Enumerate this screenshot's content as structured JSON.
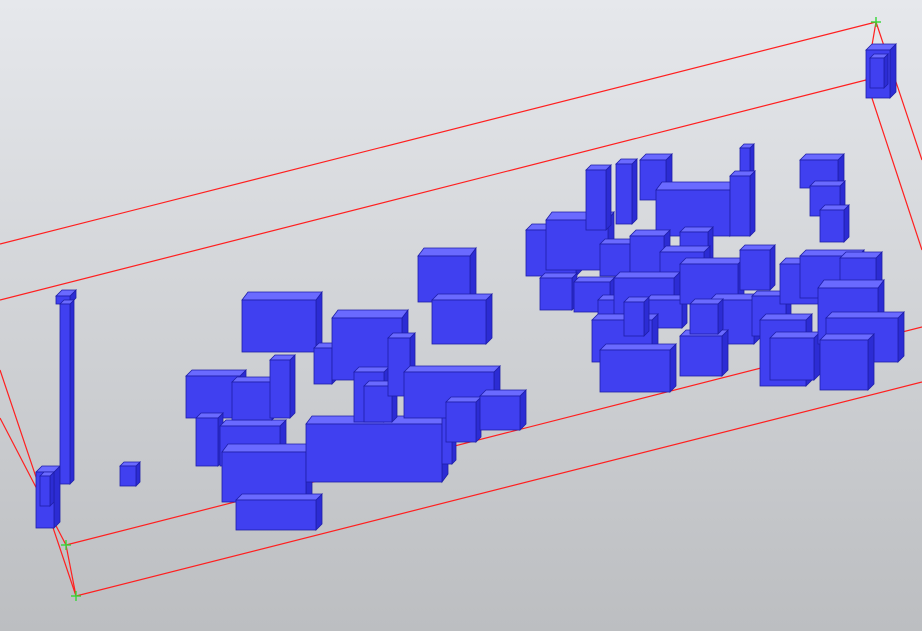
{
  "viewport": {
    "background_top": "#e6e8ec",
    "background_bottom": "#bcbec1"
  },
  "colors": {
    "model_front": "#4040f0",
    "model_top": "#6a6aff",
    "model_side": "#2c2cd4",
    "model_edge": "#1e1ea8",
    "bounding_box": "#ff1f1f",
    "corner_marker": "#36d636"
  }
}
